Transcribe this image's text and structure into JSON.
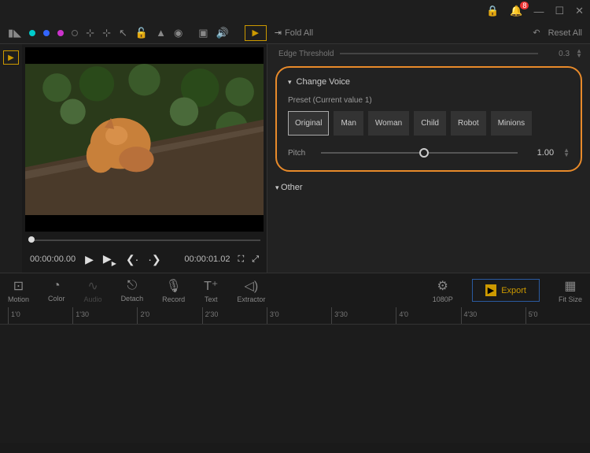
{
  "titlebar": {
    "notifications": "8"
  },
  "toolbar": {
    "foldAll": "Fold All",
    "resetAll": "Reset All"
  },
  "edge": {
    "label": "Edge Threshold",
    "value": "0.3"
  },
  "changeVoice": {
    "title": "Change Voice",
    "presetLabel": "Preset  (Current value 1)",
    "presets": [
      "Original",
      "Man",
      "Woman",
      "Child",
      "Robot",
      "Minions"
    ],
    "pitchLabel": "Pitch",
    "pitchValue": "1.00"
  },
  "other": {
    "label": "Other"
  },
  "preview": {
    "currentTime": "00:00:00.00",
    "duration": "00:00:01.02"
  },
  "tools": {
    "motion": "Motion",
    "color": "Color",
    "audio": "Audio",
    "detach": "Detach",
    "record": "Record",
    "text": "Text",
    "extractor": "Extractor",
    "res": "1080P",
    "export": "Export",
    "fit": "Fit Size"
  },
  "ruler": [
    "1'0",
    "1'30",
    "2'0",
    "2'30",
    "3'0",
    "3'30",
    "4'0",
    "4'30",
    "5'0"
  ]
}
